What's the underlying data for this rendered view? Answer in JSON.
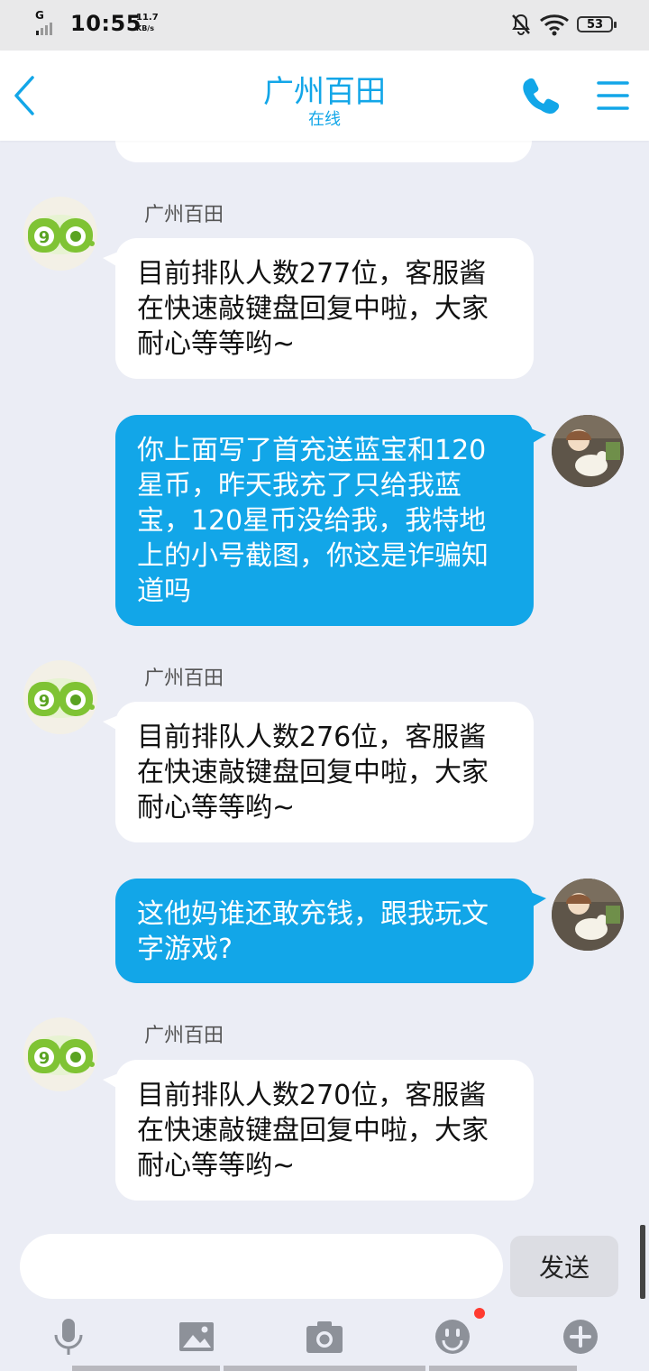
{
  "status": {
    "network": "G",
    "time": "10:55",
    "speed_value": "11.7",
    "speed_unit": "KB/s",
    "battery": "53"
  },
  "header": {
    "title": "广州百田",
    "subtitle": "在线"
  },
  "messages": [
    {
      "sender": "广州百田",
      "text": "目前排队人数277位，客服酱在快速敲键盘回复中啦，大家耐心等等哟~"
    },
    {
      "sender": "",
      "text": "你上面写了首充送蓝宝和120星币，昨天我充了只给我蓝宝，120星币没给我，我特地上的小号截图，你这是诈骗知道吗"
    },
    {
      "sender": "广州百田",
      "text": "目前排队人数276位，客服酱在快速敲键盘回复中啦，大家耐心等等哟~"
    },
    {
      "sender": "",
      "text": "这他妈谁还敢充钱，跟我玩文字游戏?"
    },
    {
      "sender": "广州百田",
      "text": "目前排队人数270位，客服酱在快速敲键盘回复中啦，大家耐心等等哟~"
    }
  ],
  "input": {
    "placeholder": "",
    "send_label": "发送"
  },
  "toolbar": [
    "mic-icon",
    "image-icon",
    "camera-icon",
    "emoji-icon",
    "plus-icon"
  ],
  "colors": {
    "accent": "#12a6e8",
    "background": "#ebedf5",
    "incoming_bubble": "#ffffff",
    "outgoing_bubble": "#12a6e8",
    "notification_dot": "#ff3b30"
  }
}
